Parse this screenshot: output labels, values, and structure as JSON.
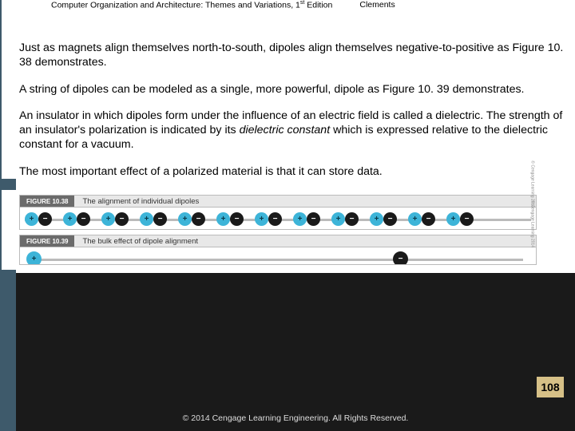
{
  "header": {
    "title_main": "Computer Organization and Architecture: Themes and Variations, 1",
    "title_sup": "st",
    "title_tail": " Edition",
    "author": "Clements"
  },
  "paragraphs": {
    "p1": "Just as magnets align themselves north-to-south, dipoles align themselves negative-to-positive as Figure 10. 38 demonstrates.",
    "p2": "A string of dipoles can be modeled as a single, more powerful, dipole as Figure 10. 39 demonstrates.",
    "p3_a": "An insulator in which dipoles form under the influence of an electric field is called a dielectric. The strength of an insulator's polarization is indicated by its ",
    "p3_i": "dielectric constant",
    "p3_b": " which is expressed relative to the dielectric constant for a vacuum.",
    "p4": "The most important effect of a polarized material is that it can store data."
  },
  "figures": {
    "f38": {
      "label": "FIGURE 10.38",
      "caption": "The alignment of individual dipoles"
    },
    "f39": {
      "label": "FIGURE 10.39",
      "caption": "The bulk effect of dipole alignment"
    },
    "side_copy": "© Cengage Learning 2014"
  },
  "symbols": {
    "plus": "+",
    "minus": "−"
  },
  "page_number": "108",
  "footer": "© 2014 Cengage Learning Engineering. All Rights Reserved."
}
